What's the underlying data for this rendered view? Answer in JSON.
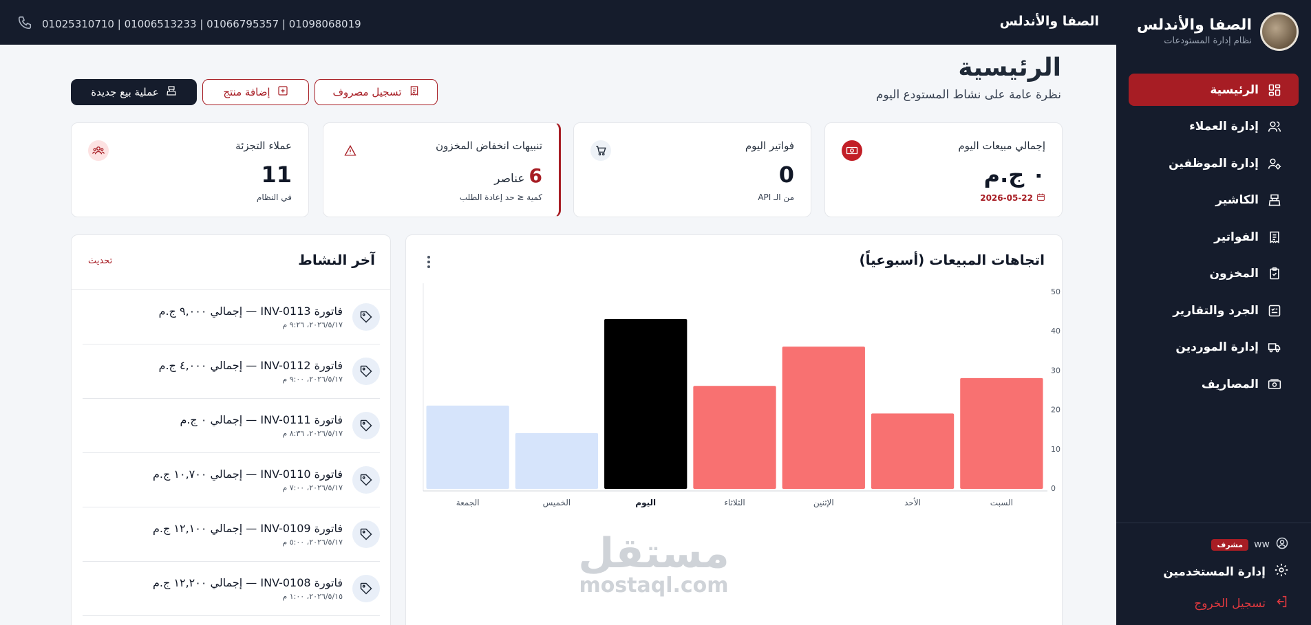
{
  "brand": {
    "name": "الصفا والأندلس",
    "subtitle": "نظام إدارة المستودعات"
  },
  "sidebar": {
    "items": [
      {
        "label": "الرئيسية",
        "icon": "dashboard-icon",
        "active": true
      },
      {
        "label": "إدارة العملاء",
        "icon": "users-icon"
      },
      {
        "label": "إدارة الموظفين",
        "icon": "user-gear-icon"
      },
      {
        "label": "الكاشير",
        "icon": "cashier-icon"
      },
      {
        "label": "الفواتير",
        "icon": "receipt-icon"
      },
      {
        "label": "المخزون",
        "icon": "clipboard-icon"
      },
      {
        "label": "الجرد والتقارير",
        "icon": "report-icon"
      },
      {
        "label": "إدارة الموردين",
        "icon": "truck-icon"
      },
      {
        "label": "المصاريف",
        "icon": "money-icon"
      }
    ],
    "user": {
      "name": "ww",
      "role": "مشرف"
    },
    "users_link": "إدارة المستخدمين",
    "logout": "تسجيل الخروج"
  },
  "topbar": {
    "title": "الصفا والأندلس",
    "phones": "01025310710 | 01006513233 | 01066795357 | 01098068019"
  },
  "header": {
    "title": "الرئيسية",
    "subtitle": "نظرة عامة على نشاط المستودع اليوم"
  },
  "actions": {
    "new_sale": "عملية بيع جديدة",
    "add_product": "إضافة منتج",
    "record_expense": "تسجيل مصروف"
  },
  "stats": {
    "sales": {
      "title": "إجمالي مبيعات اليوم",
      "value": "٠ ج.م",
      "date": "2026-05-22"
    },
    "invoices": {
      "title": "فواتير اليوم",
      "value": "0",
      "foot": "من الـ API"
    },
    "low_stock": {
      "title": "تنبيهات انخفاض المخزون",
      "value": "6",
      "unit": "عناصر",
      "foot": "كمية ≤ حد إعادة الطلب"
    },
    "customers": {
      "title": "عملاء التجزئة",
      "value": "11",
      "foot": "في النظام"
    }
  },
  "chart": {
    "title": "اتجاهات المبيعات (أسبوعياً)"
  },
  "chart_data": {
    "type": "bar",
    "categories": [
      "السبت",
      "الأحد",
      "الإثنين",
      "الثلاثاء",
      "اليوم",
      "الخميس",
      "الجمعة"
    ],
    "values": [
      28,
      19,
      36,
      26,
      43,
      14,
      21
    ],
    "colors": [
      "#f87171",
      "#f87171",
      "#f87171",
      "#f87171",
      "#000000",
      "#d6e4fb",
      "#d6e4fb"
    ],
    "highlight_category": "اليوم",
    "y_ticks": [
      "0",
      "10",
      "20",
      "30",
      "40",
      "50"
    ],
    "ylim": [
      0,
      50
    ],
    "direction": "rtl"
  },
  "activity": {
    "title": "آخر النشاط",
    "refresh": "تحديث",
    "items": [
      {
        "text": "فاتورة INV-0113 — إجمالي ٩,٠٠٠ ج.م",
        "time": "٢٠٢٦/٥/١٧، ٩:٢٦ م"
      },
      {
        "text": "فاتورة INV-0112 — إجمالي ٤,٠٠٠ ج.م",
        "time": "٢٠٢٦/٥/١٧، ٩:٠٠ م"
      },
      {
        "text": "فاتورة INV-0111 — إجمالي ٠ ج.م",
        "time": "٢٠٢٦/٥/١٧، ٨:٣٦ م"
      },
      {
        "text": "فاتورة INV-0110 — إجمالي ١٠,٧٠٠ ج.م",
        "time": "٢٠٢٦/٥/١٧، ٧:٠٠ م"
      },
      {
        "text": "فاتورة INV-0109 — إجمالي ١٢,١٠٠ ج.م",
        "time": "٢٠٢٦/٥/١٧، ٥:٠٠ م"
      },
      {
        "text": "فاتورة INV-0108 — إجمالي ١٢,٢٠٠ ج.م",
        "time": "٢٠٢٦/٥/١٥، ١:٠٠ م"
      }
    ]
  },
  "watermark": {
    "arabic": "مستقل",
    "latin": "mostaql.com"
  }
}
